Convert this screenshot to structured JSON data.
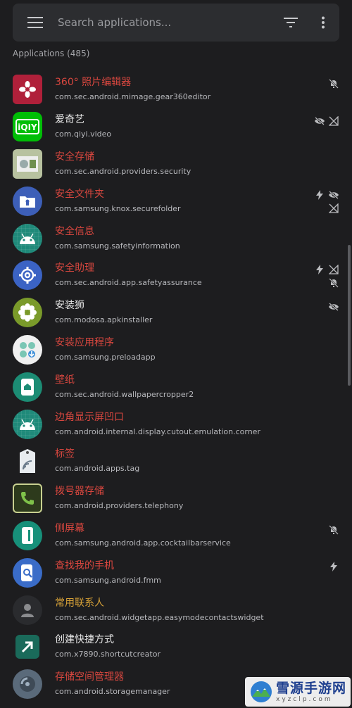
{
  "search": {
    "placeholder": "Search applications..."
  },
  "section": {
    "title": "Applications (485)"
  },
  "colors": {
    "disabled": "#d9473f",
    "normal": "#e6e6e6",
    "warning": "#d8a238"
  },
  "apps": [
    {
      "name": "360° 照片编辑器",
      "package": "com.sec.android.mimage.gear360editor",
      "state": "red",
      "icon": "gear360-icon",
      "status": [
        "no-notifications-icon"
      ]
    },
    {
      "name": "爱奇艺",
      "package": "com.qiyi.video",
      "state": "white",
      "icon": "iqiyi-icon",
      "status": [
        "hidden-icon",
        "no-network-icon"
      ]
    },
    {
      "name": "安全存储",
      "package": "com.sec.android.providers.security",
      "state": "red",
      "icon": "security-storage-icon",
      "status": []
    },
    {
      "name": "安全文件夹",
      "package": "com.samsung.knox.securefolder",
      "state": "red",
      "icon": "secure-folder-icon",
      "status": [
        "lightning-icon",
        "hidden-icon",
        "no-network-icon"
      ]
    },
    {
      "name": "安全信息",
      "package": "com.samsung.safetyinformation",
      "state": "red",
      "icon": "android-icon",
      "status": []
    },
    {
      "name": "安全助理",
      "package": "com.sec.android.app.safetyassurance",
      "state": "red",
      "icon": "settings-gear-icon",
      "status": [
        "lightning-icon",
        "no-network-icon",
        "no-notifications-icon"
      ]
    },
    {
      "name": "安装狮",
      "package": "com.modosa.apkinstaller",
      "state": "white",
      "icon": "flower-icon",
      "status": [
        "hidden-icon"
      ]
    },
    {
      "name": "安装应用程序",
      "package": "com.samsung.preloadapp",
      "state": "red",
      "icon": "preload-apps-icon",
      "status": []
    },
    {
      "name": "壁纸",
      "package": "com.sec.android.wallpapercropper2",
      "state": "red",
      "icon": "wallpaper-home-icon",
      "status": []
    },
    {
      "name": "边角显示屏凹口",
      "package": "com.android.internal.display.cutout.emulation.corner",
      "state": "red",
      "icon": "android-icon",
      "status": []
    },
    {
      "name": "标签",
      "package": "com.android.apps.tag",
      "state": "red",
      "icon": "nfc-tag-icon",
      "status": []
    },
    {
      "name": "拨号器存储",
      "package": "com.android.providers.telephony",
      "state": "red",
      "icon": "phone-icon",
      "status": []
    },
    {
      "name": "侧屏幕",
      "package": "com.samsung.android.app.cocktailbarservice",
      "state": "red",
      "icon": "edge-panel-icon",
      "status": [
        "no-notifications-icon"
      ]
    },
    {
      "name": "查找我的手机",
      "package": "com.samsung.android.fmm",
      "state": "red",
      "icon": "find-my-phone-icon",
      "status": [
        "lightning-icon"
      ]
    },
    {
      "name": "常用联系人",
      "package": "com.sec.android.widgetapp.easymodecontactswidget",
      "state": "orange",
      "icon": "contact-person-icon",
      "status": []
    },
    {
      "name": "创建快捷方式",
      "package": "com.x7890.shortcutcreator",
      "state": "white",
      "icon": "shortcut-arrow-icon",
      "status": []
    },
    {
      "name": "存储空间管理器",
      "package": "com.android.storagemanager",
      "state": "red",
      "icon": "storage-manager-icon",
      "status": []
    }
  ],
  "watermark": {
    "title": "雪源手游网",
    "sub": "xyzclp.com"
  }
}
